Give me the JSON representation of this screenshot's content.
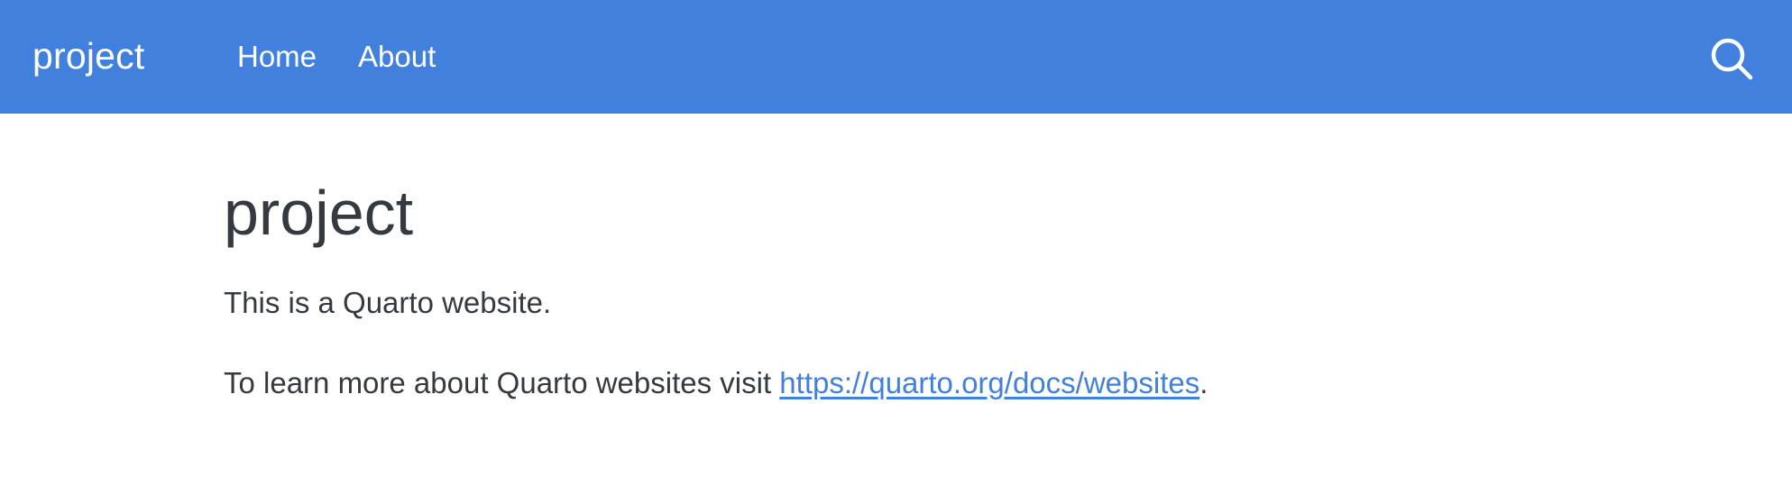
{
  "navbar": {
    "brand": "project",
    "links": [
      "Home",
      "About"
    ],
    "search_icon": "search-icon",
    "background_color": "#4280dd",
    "text_color": "#ffffff"
  },
  "main": {
    "title": "project",
    "paragraph1": "This is a Quarto website.",
    "paragraph2_prefix": "To learn more about Quarto websites visit ",
    "paragraph2_link": "https://quarto.org/docs/websites",
    "paragraph2_suffix": ".",
    "text_color": "#343a40",
    "link_color": "#4280dd"
  }
}
